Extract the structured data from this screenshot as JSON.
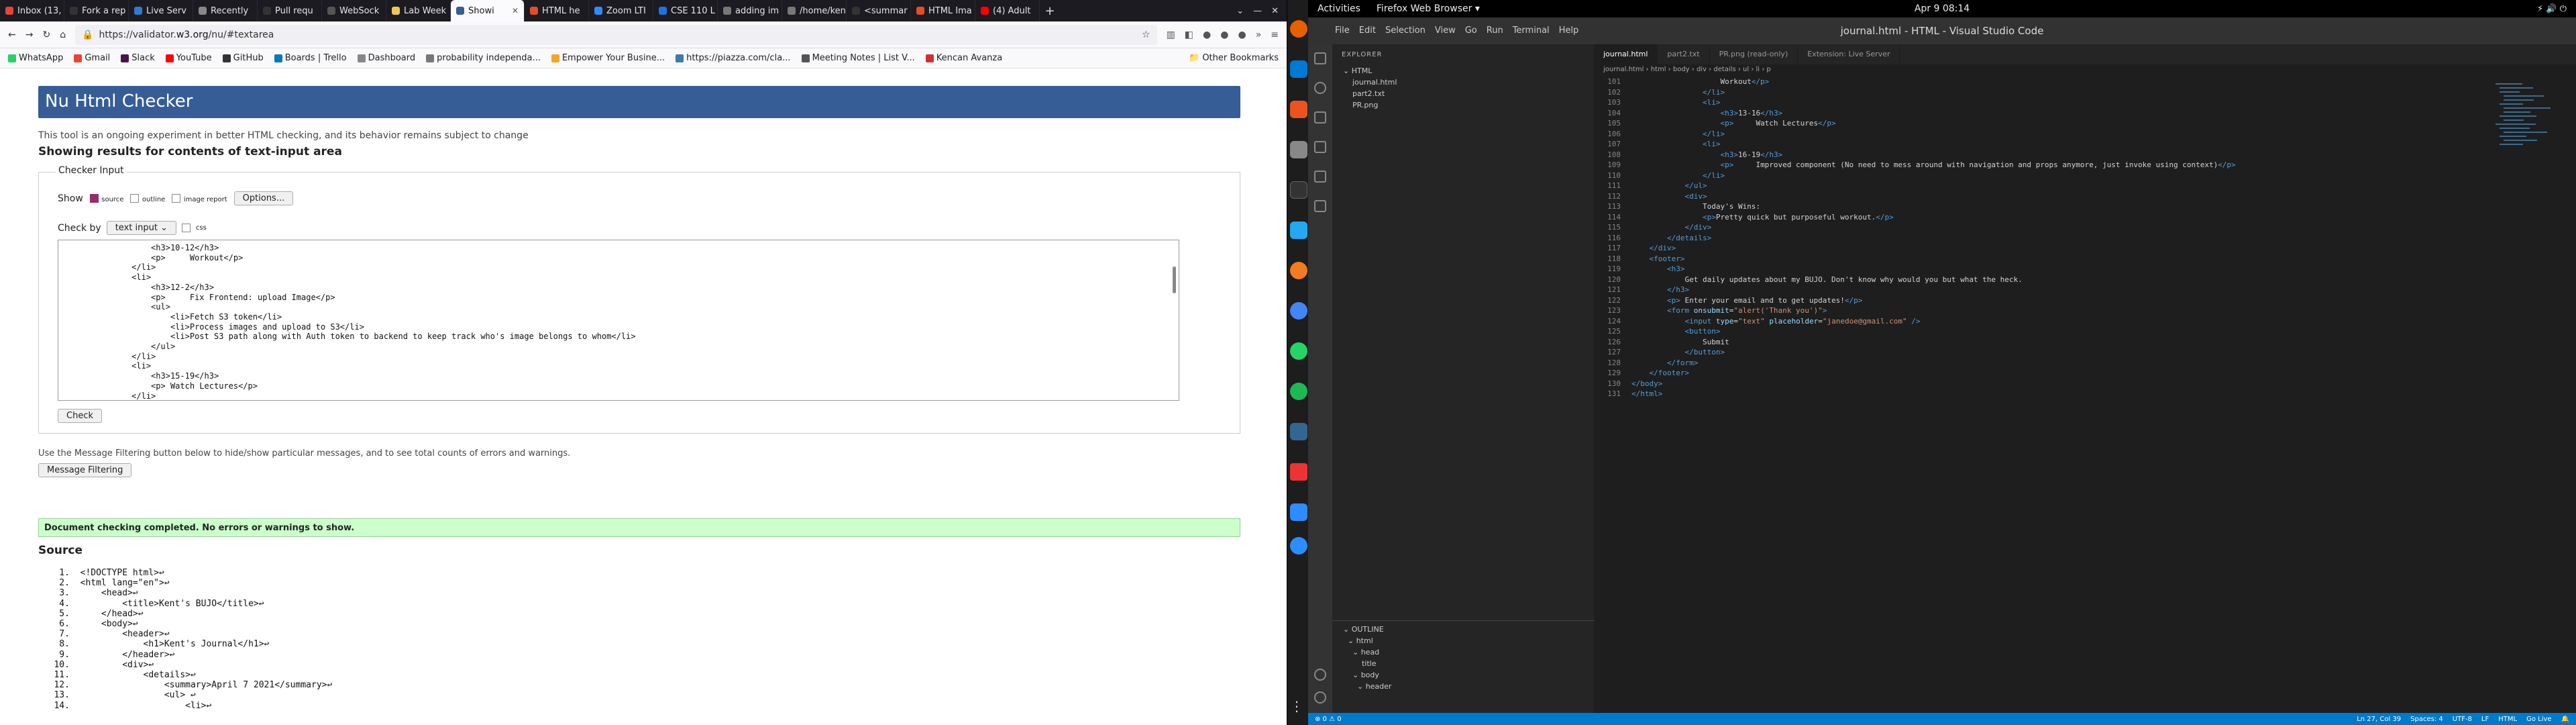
{
  "firefox": {
    "tabs": [
      {
        "label": "Inbox (13,",
        "color": "#ea4335"
      },
      {
        "label": "Fork a rep",
        "color": "#333333"
      },
      {
        "label": "Live Serv",
        "color": "#2b7cd3"
      },
      {
        "label": "Recently",
        "color": "#888888"
      },
      {
        "label": "Pull requ",
        "color": "#333333"
      },
      {
        "label": "WebSock",
        "color": "#555555"
      },
      {
        "label": "Lab Week",
        "color": "#f2c94c"
      },
      {
        "label": "Showi",
        "color": "#365d95",
        "active": true
      },
      {
        "label": "HTML he",
        "color": "#e44d26"
      },
      {
        "label": "Zoom LTI",
        "color": "#2d8cff"
      },
      {
        "label": "CSE 110 L",
        "color": "#1a73e8"
      },
      {
        "label": "adding im",
        "color": "#777777"
      },
      {
        "label": "/home/kent",
        "color": "#777777"
      },
      {
        "label": "<summar",
        "color": "#333333"
      },
      {
        "label": "HTML Ima",
        "color": "#e44d26"
      },
      {
        "label": "(4) Adult",
        "color": "#ff0000"
      }
    ],
    "url_prefix": "https://validator.",
    "url_domain": "w3.org",
    "url_suffix": "/nu/#textarea",
    "bookmarks": [
      {
        "label": "WhatsApp",
        "color": "#25d366"
      },
      {
        "label": "Gmail",
        "color": "#ea4335"
      },
      {
        "label": "Slack",
        "color": "#4a154b"
      },
      {
        "label": "YouTube",
        "color": "#ff0000"
      },
      {
        "label": "GitHub",
        "color": "#333333"
      },
      {
        "label": "Boards | Trello",
        "color": "#0079bf"
      },
      {
        "label": "Dashboard",
        "color": "#888888"
      },
      {
        "label": "probability independa...",
        "color": "#777777"
      },
      {
        "label": "Empower Your Busine...",
        "color": "#f5a623"
      },
      {
        "label": "https://piazza.com/cla...",
        "color": "#3e7aab"
      },
      {
        "label": "Meeting Notes | List V...",
        "color": "#555555"
      },
      {
        "label": "Kencan Avanza",
        "color": "#d32f2f"
      }
    ],
    "other_bookmarks": "Other Bookmarks"
  },
  "checker": {
    "title": "Nu Html Checker",
    "experiment": "This tool is an ongoing experiment in better HTML checking, and its behavior remains subject to change",
    "showing": "Showing results for contents of text-input area",
    "legend": "Checker Input",
    "show_label": "Show",
    "opt_source": "source",
    "opt_outline": "outline",
    "opt_image": "image report",
    "options_btn": "Options...",
    "checkby": "Check by",
    "checkby_value": "text input ⌄",
    "css_label": "css",
    "textarea": "                  <h3>10-12</h3>\n                  <p>     Workout</p>\n              </li>\n              <li>\n                  <h3>12-2</h3>\n                  <p>     Fix Frontend: upload Image</p>\n                  <ul>\n                      <li>Fetch S3 token</li>\n                      <li>Process images and upload to S3</li>\n                      <li>Post S3 path along with Auth token to backend to keep track who's image belongs to whom</li>\n                  </ul>\n              </li>\n              <li>\n                  <h3>15-19</h3>\n                  <p> Watch Lectures</p>\n              </li>",
    "check_btn": "Check",
    "filter_text": "Use the Message Filtering button below to hide/show particular messages, and to see total counts of errors and warnings.",
    "filter_btn": "Message Filtering",
    "done": "Document checking completed. No errors or warnings to show.",
    "source_heading": "Source",
    "source": "    1.  <!DOCTYPE html>↩\n    2.  <html lang=\"en\">↩\n    3.      <head>↩\n    4.          <title>Kent's BUJO</title>↩\n    5.      </head>↩\n    6.      <body>↩\n    7.          <header>↩\n    8.              <h1>Kent's Journal</h1>↩\n    9.          </header>↩\n   10.          <div>↩\n   11.              <details>↩\n   12.                  <summary>April 7 2021</summary>↩\n   13.                  <ul> ↩\n   14.                      <li>↩"
  },
  "ubuntu": {
    "activities": "Activities",
    "app": "Firefox Web Browser ▾",
    "clock": "Apr 9  08:14",
    "tray": "⚡  🔊  ⏻"
  },
  "vscode": {
    "title": "journal.html - HTML - Visual Studio Code",
    "menu": [
      "File",
      "Edit",
      "Selection",
      "View",
      "Go",
      "Run",
      "Terminal",
      "Help"
    ],
    "explorer_head": "EXPLORER",
    "tree": [
      "⌄ HTML",
      "    journal.html",
      "    part2.txt",
      "    PR.png"
    ],
    "outline_head": "⌄ OUTLINE",
    "outline": [
      "  ⌄ html",
      "    ⌄ head",
      "        title",
      "    ⌄ body",
      "      ⌄ header"
    ],
    "tabs": [
      "journal.html",
      "part2.txt",
      "PR.png (read-only)",
      "Extension: Live Server"
    ],
    "breadcrumb": "journal.html › html › body › div › details › ul › li › p",
    "line_start": 101,
    "lines": [
      [
        [
          "tx",
          "                    Workout"
        ],
        [
          "tg",
          "</p>"
        ]
      ],
      [
        [
          "tg",
          "                </li>"
        ]
      ],
      [
        [
          "tg",
          "                <li>"
        ]
      ],
      [
        [
          "tg",
          "                    <h3>"
        ],
        [
          "tx",
          "13-16"
        ],
        [
          "tg",
          "</h3>"
        ]
      ],
      [
        [
          "tg",
          "                    <p>"
        ],
        [
          "tx",
          "     Watch Lectures"
        ],
        [
          "tg",
          "</p>"
        ]
      ],
      [
        [
          "tg",
          "                </li>"
        ]
      ],
      [
        [
          "tg",
          "                <li>"
        ]
      ],
      [
        [
          "tg",
          "                    <h3>"
        ],
        [
          "tx",
          "16-19"
        ],
        [
          "tg",
          "</h3>"
        ]
      ],
      [
        [
          "tg",
          "                    <p>"
        ],
        [
          "tx",
          "     Improved component (No need to mess around with navigation and props anymore, just invoke using context)"
        ],
        [
          "tg",
          "</p>"
        ]
      ],
      [
        [
          "tg",
          "                </li>"
        ]
      ],
      [
        [
          "tg",
          "            </ul>"
        ]
      ],
      [
        [
          "tg",
          "            <div>"
        ]
      ],
      [
        [
          "tx",
          "                Today's Wins:"
        ]
      ],
      [
        [
          "tg",
          "                <p>"
        ],
        [
          "tx",
          "Pretty quick but purposeful workout."
        ],
        [
          "tg",
          "</p>"
        ]
      ],
      [
        [
          "tg",
          "            </div>"
        ]
      ],
      [
        [
          "tg",
          "        </details>"
        ]
      ],
      [
        [
          "tg",
          "    </div>"
        ]
      ],
      [
        [
          "tg",
          "    <footer>"
        ]
      ],
      [
        [
          "tg",
          "        <h3>"
        ]
      ],
      [
        [
          "tx",
          "            Get daily updates about my BUJO. Don't know why would you but what the heck."
        ]
      ],
      [
        [
          "tg",
          "        </h3>"
        ]
      ],
      [
        [
          "tg",
          "        <p>"
        ],
        [
          "tx",
          " Enter your email and to get updates!"
        ],
        [
          "tg",
          "</p>"
        ]
      ],
      [
        [
          "tg",
          "        <form "
        ],
        [
          "at",
          "onsubmit"
        ],
        [
          "tx",
          "="
        ],
        [
          "st",
          "\"alert('Thank you')\""
        ],
        [
          "tg",
          ">"
        ]
      ],
      [
        [
          "tg",
          "            <input "
        ],
        [
          "at",
          "type"
        ],
        [
          "tx",
          "="
        ],
        [
          "st",
          "\"text\""
        ],
        [
          "at",
          " placeholder"
        ],
        [
          "tx",
          "="
        ],
        [
          "st",
          "\"janedoe@gmail.com\""
        ],
        [
          "tg",
          " />"
        ]
      ],
      [
        [
          "tg",
          "            <button>"
        ]
      ],
      [
        [
          "tx",
          "                Submit"
        ]
      ],
      [
        [
          "tg",
          "            </button>"
        ]
      ],
      [
        [
          "tg",
          "        </form>"
        ]
      ],
      [
        [
          "tg",
          "    </footer>"
        ]
      ],
      [
        [
          "tg",
          "</body>"
        ]
      ],
      [
        [
          "tg",
          "</html>"
        ]
      ]
    ],
    "status_left": "⊗ 0  ⚠ 0",
    "status_right": [
      "Ln 27, Col 39",
      "Spaces: 4",
      "UTF-8",
      "LF",
      "HTML",
      "Go Live",
      "🔔"
    ]
  }
}
